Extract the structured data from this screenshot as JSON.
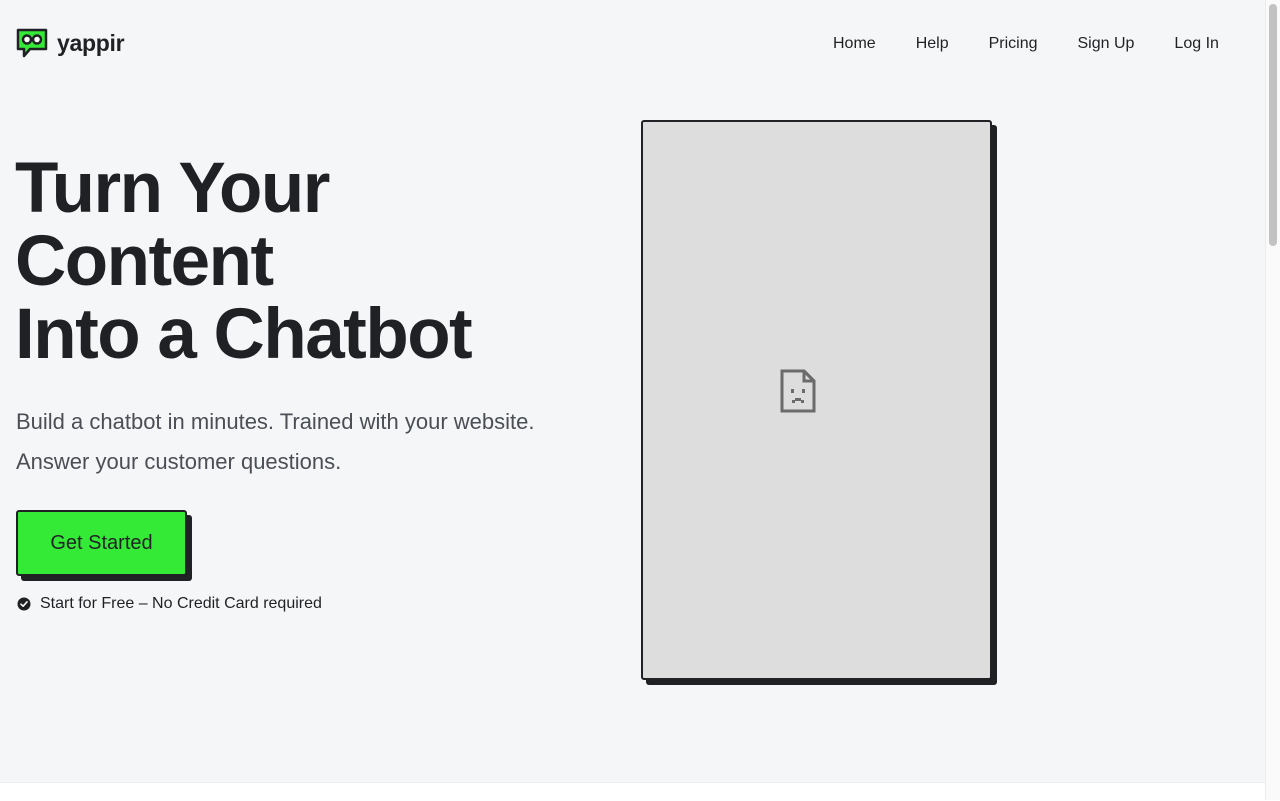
{
  "brand": {
    "name": "yappir",
    "logo_icon": "chat-bubble-eyes-icon",
    "accent_color": "#35ea37"
  },
  "nav": {
    "items": [
      {
        "label": "Home"
      },
      {
        "label": "Help"
      },
      {
        "label": "Pricing"
      },
      {
        "label": "Sign Up"
      },
      {
        "label": "Log In"
      }
    ]
  },
  "hero": {
    "title_lines": [
      "Turn Your",
      "Content",
      "Into a Chatbot"
    ],
    "subtitle_lines": [
      "Build a chatbot in minutes. Trained with your website.",
      "Answer your customer questions."
    ],
    "cta_label": "Get Started",
    "note_icon": "check-circle-icon",
    "note_text": "Start for Free – No Credit Card required"
  },
  "embed": {
    "state": "broken",
    "icon": "broken-document-icon"
  }
}
